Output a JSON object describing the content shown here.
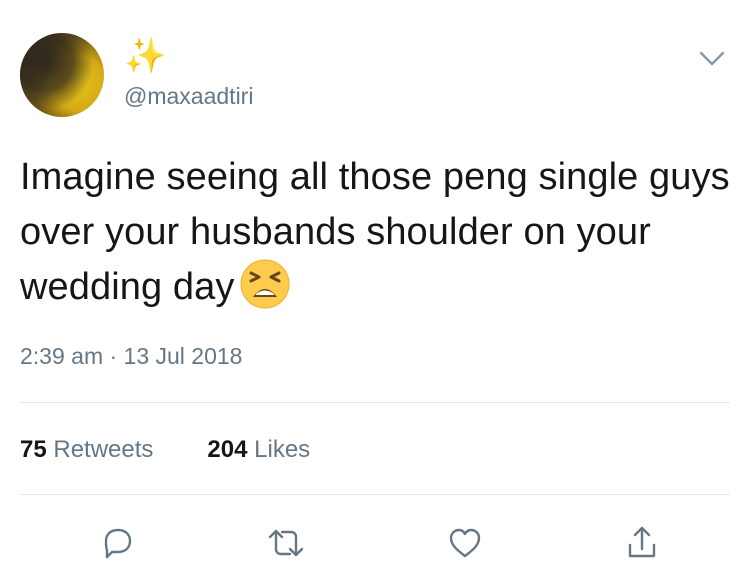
{
  "user": {
    "display_name": "✨",
    "handle": "@maxaadtiri"
  },
  "tweet": {
    "text": "Imagine seeing all those peng single guys over your husbands shoulder on your wedding day",
    "emoji": "tired-face-emoji",
    "timestamp": "2:39 am · 13 Jul 2018"
  },
  "stats": {
    "retweets_count": "75",
    "retweets_label": "Retweets",
    "likes_count": "204",
    "likes_label": "Likes"
  },
  "icons": {
    "menu": "chevron-down-icon",
    "reply": "reply-icon",
    "retweet": "retweet-icon",
    "like": "heart-icon",
    "share": "share-icon"
  },
  "colors": {
    "text": "#14171a",
    "secondary": "#657786",
    "icon": "#657786",
    "divider": "#e1e8ed",
    "sparkle": "#f0b600"
  }
}
